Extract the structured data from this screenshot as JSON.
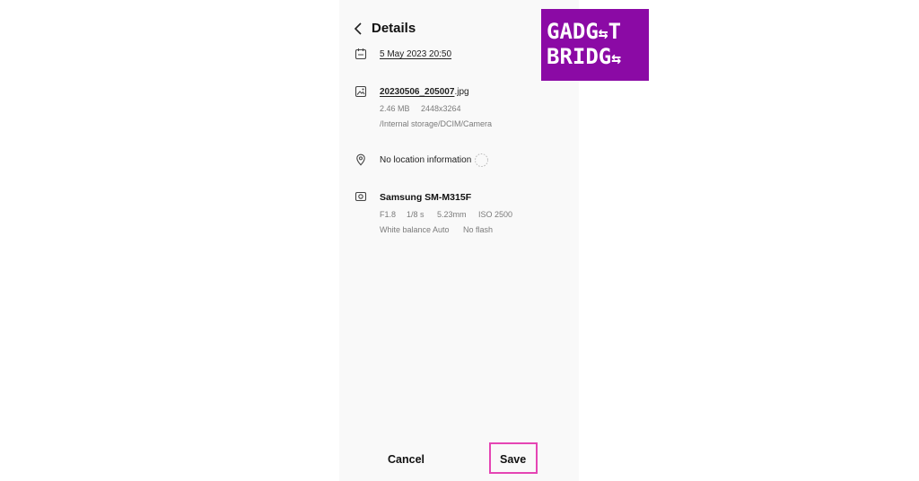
{
  "header": {
    "title": "Details"
  },
  "date": {
    "value": "5 May 2023 20:50"
  },
  "file": {
    "name_bold": "20230506_205007",
    "name_ext": ".jpg",
    "size": "2.46 MB",
    "resolution": "2448x3264",
    "path": "/Internal storage/DCIM/Camera"
  },
  "location": {
    "text": "No location information"
  },
  "camera": {
    "model": "Samsung SM-M315F",
    "aperture": "F1.8",
    "shutter": "1/8 s",
    "focal": "5.23mm",
    "iso": "ISO 2500",
    "white_balance": "White balance Auto",
    "flash": "No flash"
  },
  "footer": {
    "cancel_label": "Cancel",
    "save_label": "Save"
  },
  "logo": {
    "line1": "GADG T",
    "line2": "BRIDG",
    "brand_color": "#8b0aa5"
  },
  "colors": {
    "highlight": "#e545b4"
  }
}
